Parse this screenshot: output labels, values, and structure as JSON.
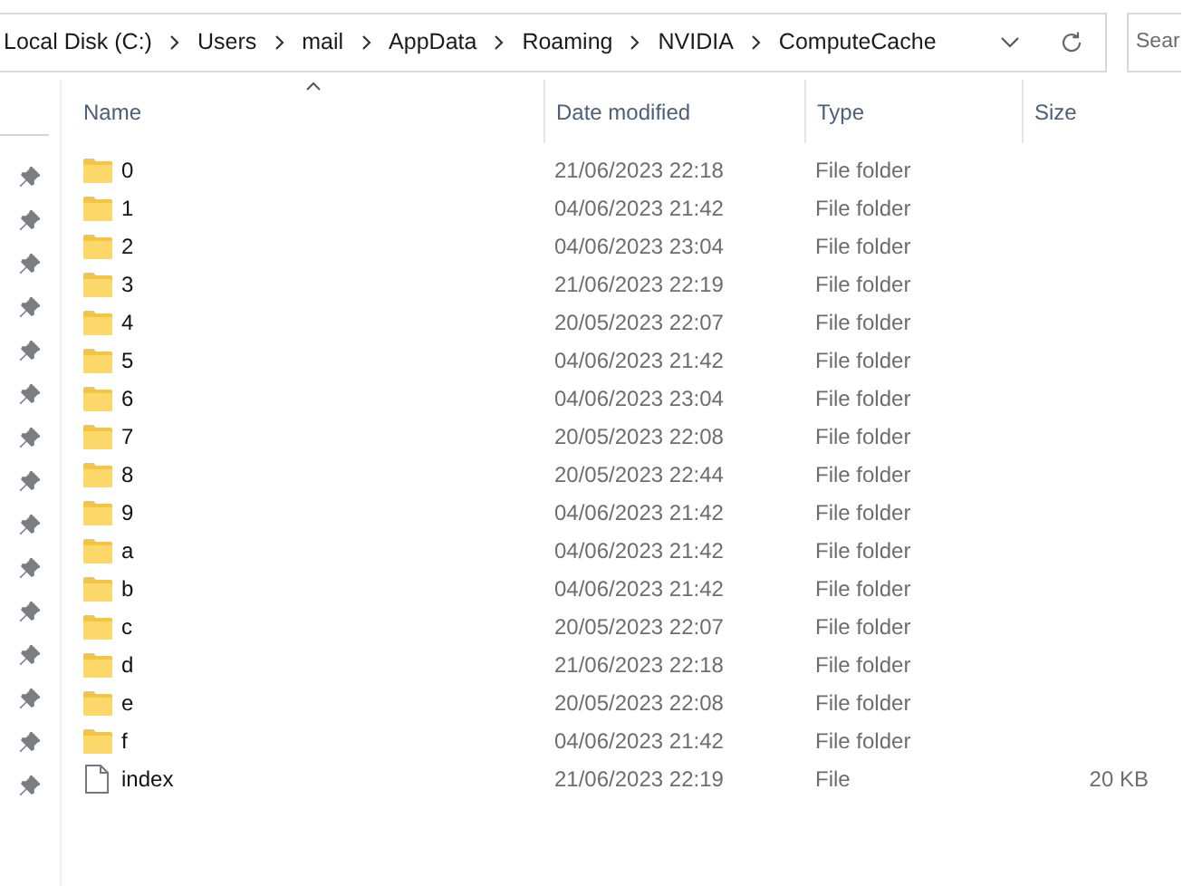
{
  "address_bar": {
    "segments": [
      "Local Disk (C:)",
      "Users",
      "mail",
      "AppData",
      "Roaming",
      "NVIDIA",
      "ComputeCache"
    ]
  },
  "search": {
    "placeholder": "Sear"
  },
  "columns": [
    {
      "label": "Name",
      "sorted": true
    },
    {
      "label": "Date modified",
      "sorted": false
    },
    {
      "label": "Type",
      "sorted": false
    },
    {
      "label": "Size",
      "sorted": false
    }
  ],
  "rows": [
    {
      "kind": "folder",
      "name": "0",
      "date": "21/06/2023 22:18",
      "type": "File folder"
    },
    {
      "kind": "folder",
      "name": "1",
      "date": "04/06/2023 21:42",
      "type": "File folder"
    },
    {
      "kind": "folder",
      "name": "2",
      "date": "04/06/2023 23:04",
      "type": "File folder"
    },
    {
      "kind": "folder",
      "name": "3",
      "date": "21/06/2023 22:19",
      "type": "File folder"
    },
    {
      "kind": "folder",
      "name": "4",
      "date": "20/05/2023 22:07",
      "type": "File folder"
    },
    {
      "kind": "folder",
      "name": "5",
      "date": "04/06/2023 21:42",
      "type": "File folder"
    },
    {
      "kind": "folder",
      "name": "6",
      "date": "04/06/2023 23:04",
      "type": "File folder"
    },
    {
      "kind": "folder",
      "name": "7",
      "date": "20/05/2023 22:08",
      "type": "File folder"
    },
    {
      "kind": "folder",
      "name": "8",
      "date": "20/05/2023 22:44",
      "type": "File folder"
    },
    {
      "kind": "folder",
      "name": "9",
      "date": "04/06/2023 21:42",
      "type": "File folder"
    },
    {
      "kind": "folder",
      "name": "a",
      "date": "04/06/2023 21:42",
      "type": "File folder"
    },
    {
      "kind": "folder",
      "name": "b",
      "date": "04/06/2023 21:42",
      "type": "File folder"
    },
    {
      "kind": "folder",
      "name": "c",
      "date": "20/05/2023 22:07",
      "type": "File folder"
    },
    {
      "kind": "folder",
      "name": "d",
      "date": "21/06/2023 22:18",
      "type": "File folder"
    },
    {
      "kind": "folder",
      "name": "e",
      "date": "20/05/2023 22:08",
      "type": "File folder"
    },
    {
      "kind": "folder",
      "name": "f",
      "date": "04/06/2023 21:42",
      "type": "File folder"
    },
    {
      "kind": "file",
      "name": "index",
      "date": "21/06/2023 22:19",
      "type": "File",
      "size": "20 KB"
    }
  ]
}
